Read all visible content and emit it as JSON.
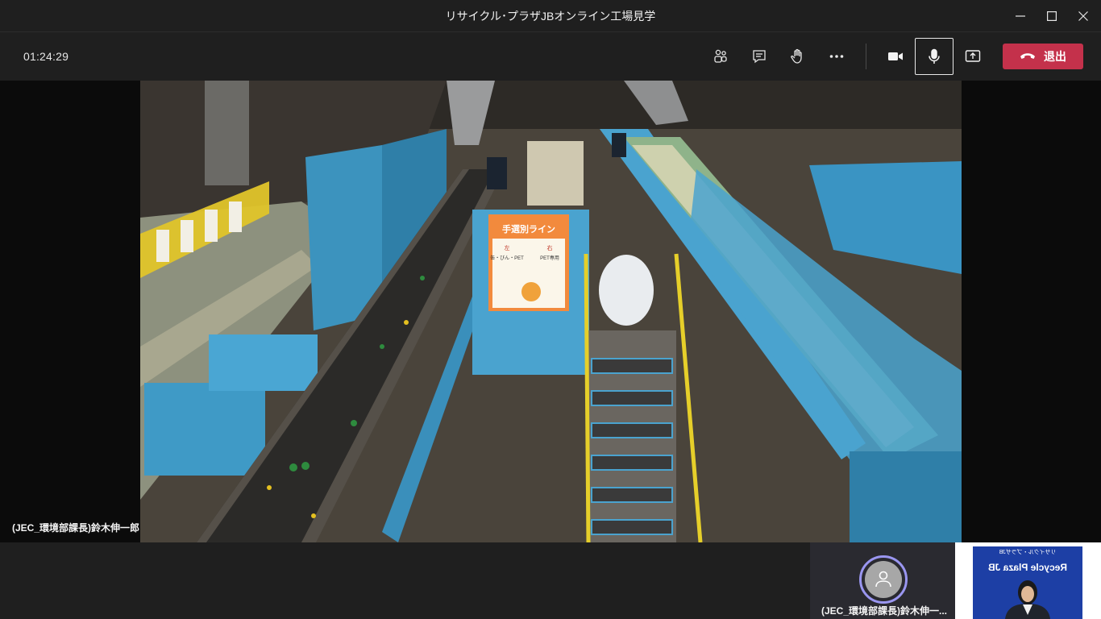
{
  "window": {
    "title": "リサイクル･プラザJBオンライン工場見学",
    "controls": {
      "minimize_icon": "minimize-icon",
      "maximize_icon": "maximize-icon",
      "close_icon": "close-icon"
    }
  },
  "toolbar": {
    "elapsed_time": "01:24:29",
    "buttons": [
      {
        "name": "participants",
        "icon": "people-icon"
      },
      {
        "name": "chat",
        "icon": "chat-icon"
      },
      {
        "name": "raise-hand",
        "icon": "hand-icon"
      },
      {
        "name": "more-actions",
        "icon": "more-icon"
      },
      {
        "name": "camera",
        "icon": "camera-icon"
      },
      {
        "name": "microphone",
        "icon": "mic-icon",
        "active": true
      },
      {
        "name": "share",
        "icon": "share-icon"
      }
    ],
    "leave": {
      "label": "退出",
      "icon": "hang-up-icon",
      "color": "#c4314b"
    }
  },
  "stage": {
    "participant_name": "(JEC_環境部課長)鈴木伸一郎",
    "sign": {
      "title": "手選別ライン",
      "left_label": "左",
      "right_label": "右",
      "left_text": "缶・びん・PET",
      "right_text": "PET専用"
    }
  },
  "strip": {
    "participant_tile": {
      "name": "(JEC_環境部課長)鈴木伸一...",
      "avatar_icon": "person-icon",
      "ring_color": "#9a96f0"
    },
    "self_view": {
      "banner_text_1": "リサイクル・プラザJB",
      "banner_text_2": "Recycle Plaza JB",
      "banner_color": "#1d3fa5"
    }
  },
  "colors": {
    "background": "#0b0b0b",
    "toolbar": "#1f1f1f",
    "accent_leave": "#c4314b"
  }
}
